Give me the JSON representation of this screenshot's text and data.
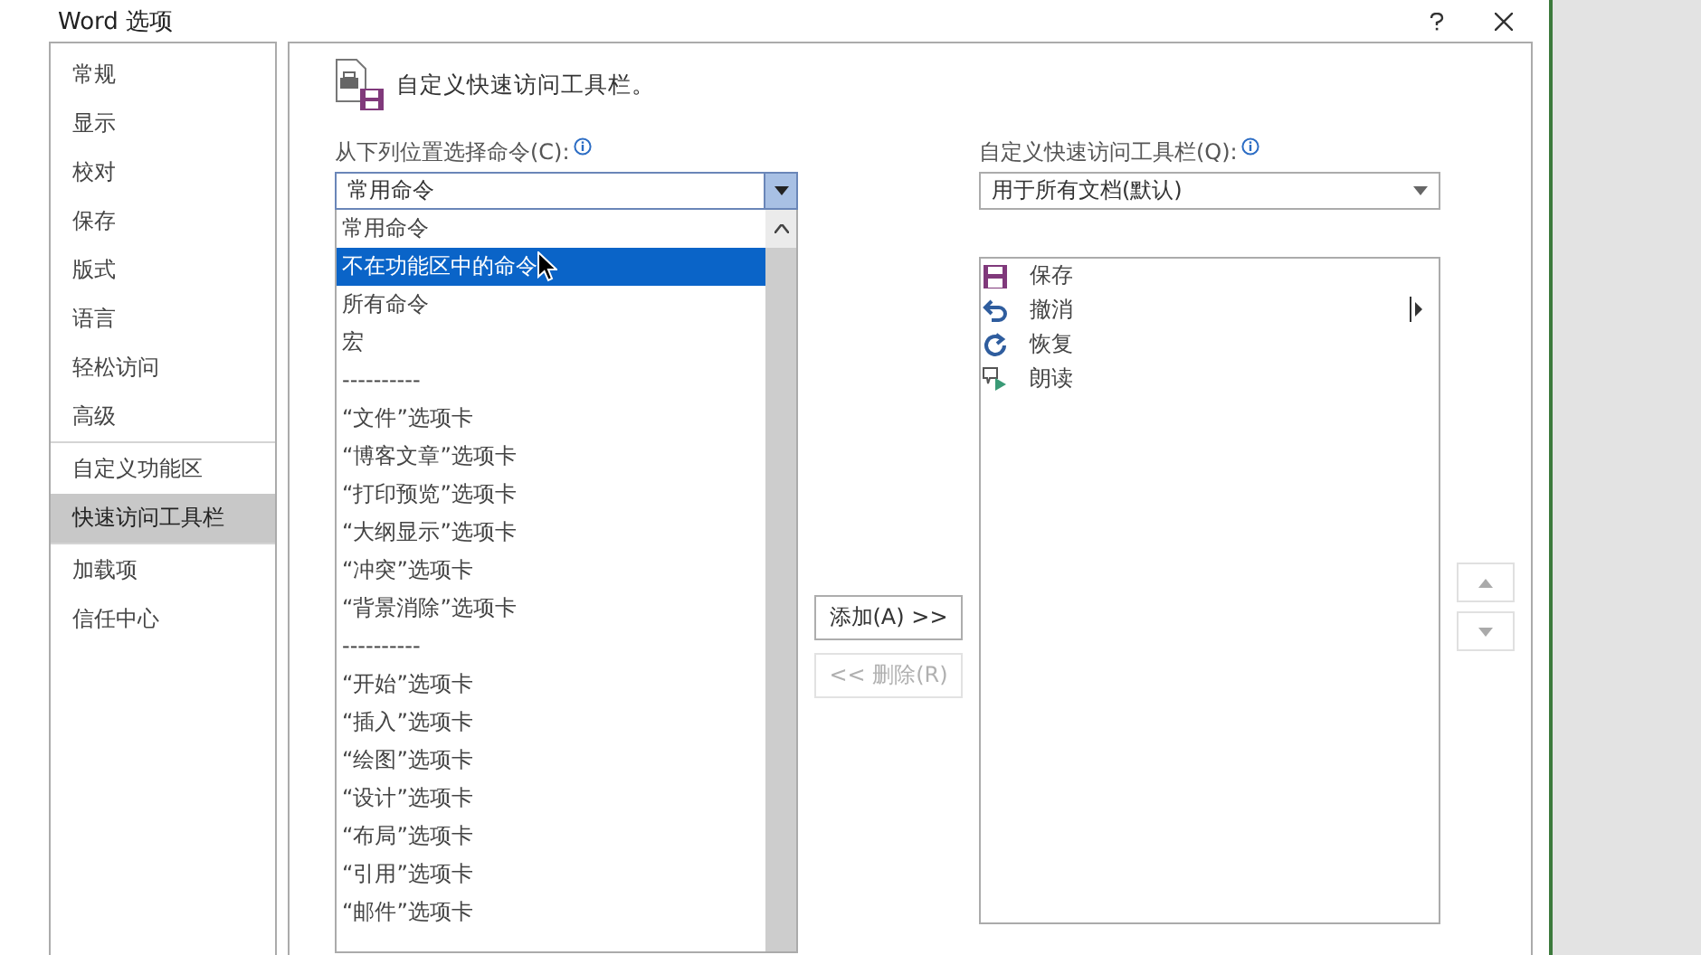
{
  "window": {
    "title": "Word 选项"
  },
  "sidebar": {
    "sections": [
      {
        "items": [
          {
            "label": "常规",
            "selected": false
          },
          {
            "label": "显示",
            "selected": false
          },
          {
            "label": "校对",
            "selected": false
          },
          {
            "label": "保存",
            "selected": false
          },
          {
            "label": "版式",
            "selected": false
          },
          {
            "label": "语言",
            "selected": false
          },
          {
            "label": "轻松访问",
            "selected": false
          },
          {
            "label": "高级",
            "selected": false
          }
        ]
      },
      {
        "items": [
          {
            "label": "自定义功能区",
            "selected": false
          },
          {
            "label": "快速访问工具栏",
            "selected": true
          }
        ]
      },
      {
        "items": [
          {
            "label": "加载项",
            "selected": false
          },
          {
            "label": "信任中心",
            "selected": false
          }
        ]
      }
    ]
  },
  "header": {
    "title": "自定义快速访问工具栏。"
  },
  "commands": {
    "label": "从下列位置选择命令(C):",
    "value": "常用命令",
    "options": [
      {
        "label": "常用命令",
        "highlighted": false
      },
      {
        "label": "不在功能区中的命令",
        "highlighted": true
      },
      {
        "label": "所有命令",
        "highlighted": false
      },
      {
        "label": "宏",
        "highlighted": false
      },
      {
        "label": "----------",
        "highlighted": false
      },
      {
        "label": "“文件”选项卡",
        "highlighted": false
      },
      {
        "label": "“博客文章”选项卡",
        "highlighted": false
      },
      {
        "label": "“打印预览”选项卡",
        "highlighted": false
      },
      {
        "label": "“大纲显示”选项卡",
        "highlighted": false
      },
      {
        "label": "“冲突”选项卡",
        "highlighted": false
      },
      {
        "label": "“背景消除”选项卡",
        "highlighted": false
      },
      {
        "label": "----------",
        "highlighted": false
      },
      {
        "label": "“开始”选项卡",
        "highlighted": false
      },
      {
        "label": "“插入”选项卡",
        "highlighted": false
      },
      {
        "label": "“绘图”选项卡",
        "highlighted": false
      },
      {
        "label": "“设计”选项卡",
        "highlighted": false
      },
      {
        "label": "“布局”选项卡",
        "highlighted": false
      },
      {
        "label": "“引用”选项卡",
        "highlighted": false
      },
      {
        "label": "“邮件”选项卡",
        "highlighted": false
      }
    ]
  },
  "buttons": [
    {
      "label": "添加(A) >>",
      "disabled": false
    },
    {
      "label": "<< 删除(R)",
      "disabled": true
    }
  ],
  "toolbar": {
    "label": "自定义快速访问工具栏(Q):",
    "value": "用于所有文档(默认)",
    "items": [
      {
        "label": "保存",
        "kind": "save"
      },
      {
        "label": "撤消",
        "kind": "undo"
      },
      {
        "label": "恢复",
        "kind": "redo"
      },
      {
        "label": "朗读",
        "kind": "read"
      }
    ]
  }
}
